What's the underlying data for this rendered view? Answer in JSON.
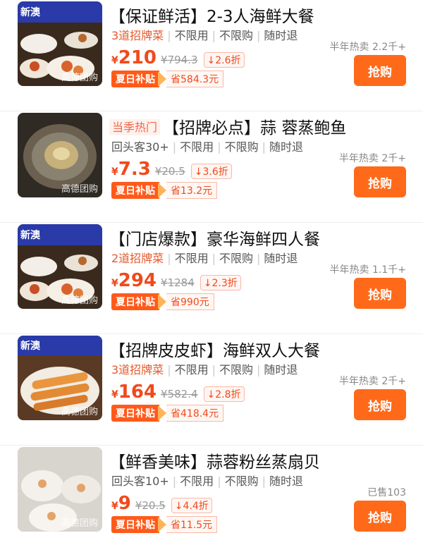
{
  "watermark": "高德团购",
  "subsidy_label": "夏日补贴",
  "buy_label": "抢购",
  "yen": "¥",
  "brand_color": "#ff6a1a",
  "price_color": "#f04a1c",
  "items": [
    {
      "title": "【保证鲜活】2-3人海鲜大餐",
      "hot": "",
      "tags": [
        "3道招牌菜",
        "不限用",
        "不限购",
        "随时退"
      ],
      "price": "210",
      "orig": "¥794.3",
      "disc": "2.6折",
      "save": "省584.3元",
      "sales": "半年热卖 2.2千+"
    },
    {
      "title": "【招牌必点】蒜 蓉蒸鲍鱼",
      "hot": "当季热门",
      "tags": [
        "回头客30+",
        "不限用",
        "不限购",
        "随时退"
      ],
      "price": "7.3",
      "orig": "¥20.5",
      "disc": "3.6折",
      "save": "省13.2元",
      "sales": "半年热卖 2千+"
    },
    {
      "title": "【门店爆款】豪华海鲜四人餐",
      "hot": "",
      "tags": [
        "2道招牌菜",
        "不限用",
        "不限购",
        "随时退"
      ],
      "price": "294",
      "orig": "¥1284",
      "disc": "2.3折",
      "save": "省990元",
      "sales": "半年热卖 1.1千+"
    },
    {
      "title": "【招牌皮皮虾】海鲜双人大餐",
      "hot": "",
      "tags": [
        "3道招牌菜",
        "不限用",
        "不限购",
        "随时退"
      ],
      "price": "164",
      "orig": "¥582.4",
      "disc": "2.8折",
      "save": "省418.4元",
      "sales": "半年热卖 2千+"
    },
    {
      "title": "【鲜香美味】蒜蓉粉丝蒸扇贝",
      "hot": "",
      "tags": [
        "回头客10+",
        "不限用",
        "不限购",
        "随时退"
      ],
      "price": "9",
      "orig": "¥20.5",
      "disc": "4.4折",
      "save": "省11.5元",
      "sales": "已售103"
    }
  ]
}
